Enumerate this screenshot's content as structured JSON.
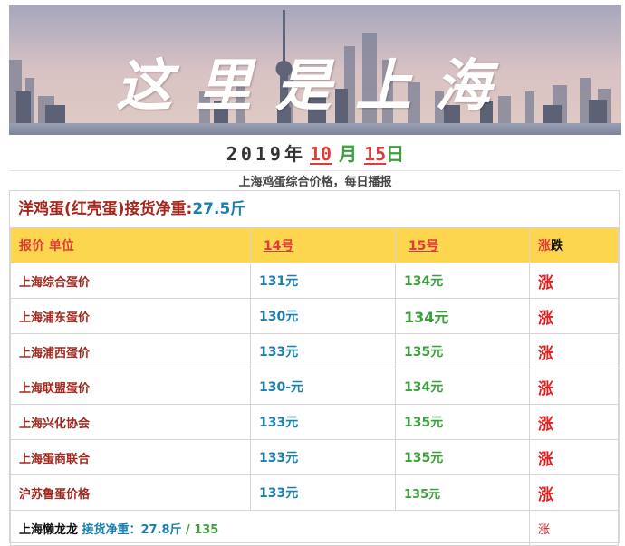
{
  "banner": {
    "title": "这里是上海"
  },
  "date": {
    "year": "2019",
    "year_unit": "年",
    "month": "10",
    "month_unit": "月",
    "day": "15",
    "day_unit": "日"
  },
  "subtitle": "上海鸡蛋综合价格，每日播报",
  "headline": {
    "label": "洋鸡蛋(红壳蛋)接货净重:",
    "value": "27.5斤"
  },
  "table": {
    "headers": {
      "name": "报价 单位",
      "d14": "14号",
      "d15": "15号",
      "change_up": "涨",
      "change_down": "跌"
    },
    "rows": [
      {
        "name": "上海综合蛋价",
        "d14": "131元",
        "d15": "134元",
        "change": "涨"
      },
      {
        "name": "上海浦东蛋价",
        "d14": "130元",
        "d15": "134元",
        "change": "涨"
      },
      {
        "name": "上海浦西蛋价",
        "d14": "133元",
        "d15": "135元",
        "change": "涨"
      },
      {
        "name": "上海联盟蛋价",
        "d14": "130-元",
        "d15": "134元",
        "change": "涨"
      },
      {
        "name": "上海兴化协会",
        "d14": "133元",
        "d15": "135元",
        "change": "涨"
      },
      {
        "name": "上海蛋商联合",
        "d14": "133元",
        "d15": "135元",
        "change": "涨"
      },
      {
        "name": "沪苏鲁蛋价格",
        "d14": "133元",
        "d15": "135元",
        "change": "涨"
      }
    ],
    "footer": {
      "name": "上海懒龙龙",
      "weight": "接货净重：27.8斤",
      "sep": "/",
      "price": "135",
      "change": "涨"
    }
  },
  "colors": {
    "header_bg": "#fdd650",
    "name": "#a3271c",
    "blue": "#1a7fb0",
    "green": "#3ca13c",
    "up": "#e32020"
  }
}
